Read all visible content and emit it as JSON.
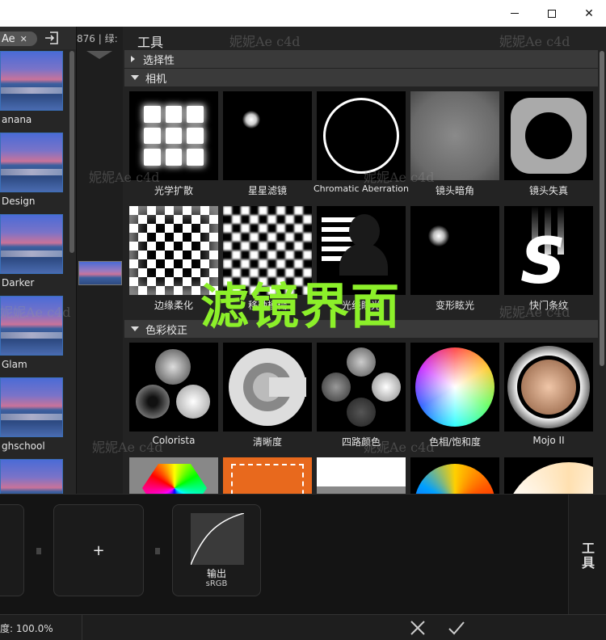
{
  "window": {
    "minimize_symbol": "",
    "close_symbol": "✕"
  },
  "left_panel": {
    "search_text": "Ae",
    "clear_symbol": "✕",
    "presets": [
      {
        "name": "anana"
      },
      {
        "name": "Design"
      },
      {
        "name": "Darker"
      },
      {
        "name": "Glam"
      },
      {
        "name": "ghschool"
      },
      {
        "name": ""
      }
    ]
  },
  "mid_column": {
    "header_text": "876 | 绿:"
  },
  "tools_panel": {
    "title": "工具",
    "sections": [
      {
        "label": "选择性",
        "expanded": false
      },
      {
        "label": "相机",
        "expanded": true
      },
      {
        "label": "色彩校正",
        "expanded": true
      }
    ],
    "camera_tools": [
      {
        "label": "光学扩散"
      },
      {
        "label": "星星滤镜"
      },
      {
        "label": "Chromatic Aberration"
      },
      {
        "label": "镜头暗角"
      },
      {
        "label": "镜头失真"
      },
      {
        "label": "边缘柔化"
      },
      {
        "label": "移轴模糊"
      },
      {
        "label": "光线眩光"
      },
      {
        "label": "变形眩光"
      },
      {
        "label": "快门条纹"
      }
    ],
    "color_tools": [
      {
        "label": "Colorista"
      },
      {
        "label": "清晰度"
      },
      {
        "label": "四路颜色"
      },
      {
        "label": "色相/饱和度"
      },
      {
        "label": "Mojo II"
      }
    ],
    "shutter_letter": "S"
  },
  "overlay_title": "滤镜界面",
  "watermark": "妮妮Ae c4d",
  "chain": {
    "add_symbol": "+",
    "output_name": "输出",
    "output_sub": "sRGB",
    "side_tab_label": "工具"
  },
  "status_bar": {
    "zoom_text": "度: 100.0%"
  },
  "colors": {
    "background": "#1d1d1d",
    "panel": "#232323",
    "section_header": "#3a3a3a",
    "overlay_text": "#8cf02a"
  }
}
